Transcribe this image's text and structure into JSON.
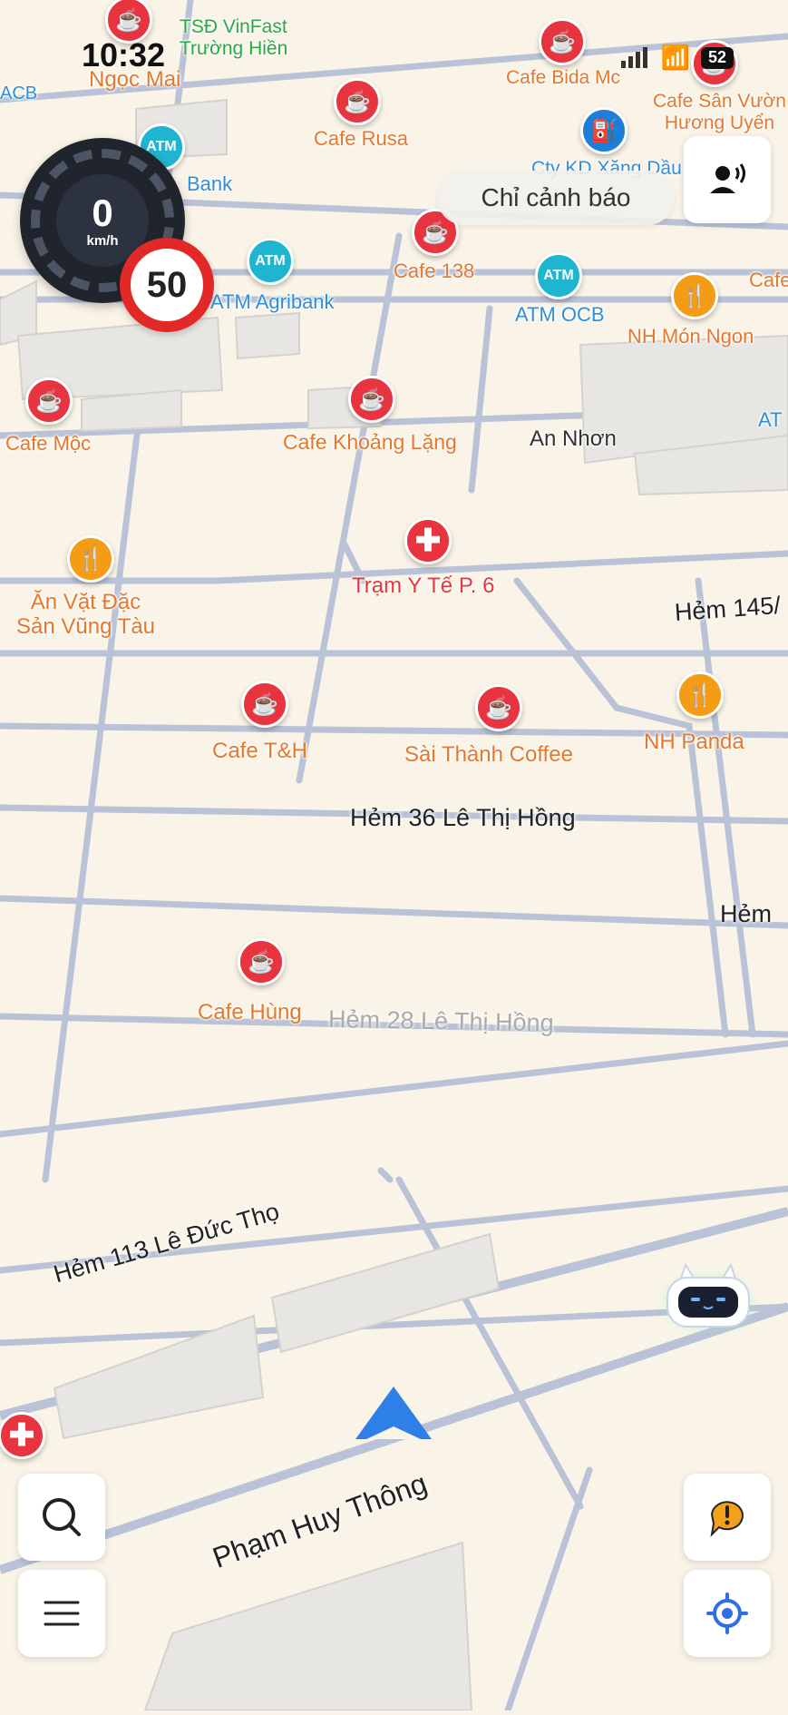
{
  "status_bar": {
    "time": "10:32",
    "battery": "52"
  },
  "speedometer": {
    "speed": "0",
    "unit": "km/h",
    "speed_limit": "50"
  },
  "alert_chip": {
    "label": "Chỉ cảnh báo"
  },
  "pois": [
    {
      "name": "TSĐ VinFast\nTrường Hiền",
      "type": "green"
    },
    {
      "name": "Ngọc Mai",
      "type": "cafe"
    },
    {
      "name": "Cafe Bida Mc",
      "type": "cafe"
    },
    {
      "name": "Cafe Sân Vườn\nHương Uyển",
      "type": "cafe"
    },
    {
      "name": "Cafe Rusa",
      "type": "cafe"
    },
    {
      "name": "Bank",
      "type": "atm"
    },
    {
      "name": "Cty KD Xăng Dầu",
      "type": "fuel"
    },
    {
      "name": "Cafe 138",
      "type": "cafe"
    },
    {
      "name": "ATM Agribank",
      "type": "atm"
    },
    {
      "name": "ATM OCB",
      "type": "atm"
    },
    {
      "name": "NH Món Ngon",
      "type": "food"
    },
    {
      "name": "Cafe Mộc",
      "type": "cafe"
    },
    {
      "name": "Cafe Khoảng Lặng",
      "type": "cafe"
    },
    {
      "name": "An Nhơn",
      "type": "area"
    },
    {
      "name": "Ăn Vặt Đặc\nSản Vũng Tàu",
      "type": "food"
    },
    {
      "name": "Trạm Y Tế P. 6",
      "type": "medical"
    },
    {
      "name": "Cafe T&H",
      "type": "cafe"
    },
    {
      "name": "Sài Thành Coffee",
      "type": "cafe"
    },
    {
      "name": "NH Panda",
      "type": "food"
    },
    {
      "name": "Cafe Hùng",
      "type": "cafe"
    },
    {
      "name": "ACB",
      "type": "atm"
    },
    {
      "name": "Cafe",
      "type": "cafe"
    },
    {
      "name": "AT",
      "type": "atm"
    }
  ],
  "streets": [
    {
      "name": "Hẻm 145/"
    },
    {
      "name": "Hẻm 36 Lê Thị Hồng"
    },
    {
      "name": "Hẻm"
    },
    {
      "name": "Hẻm 28 Lê Thị Hồng"
    },
    {
      "name": "Hẻm 113 Lê Đức Thọ"
    },
    {
      "name": "Phạm Huy Thông"
    }
  ],
  "controls": {
    "search": "search-icon",
    "menu": "menu-icon",
    "report": "report-icon",
    "locate": "locate-icon",
    "voice": "voice-icon"
  }
}
